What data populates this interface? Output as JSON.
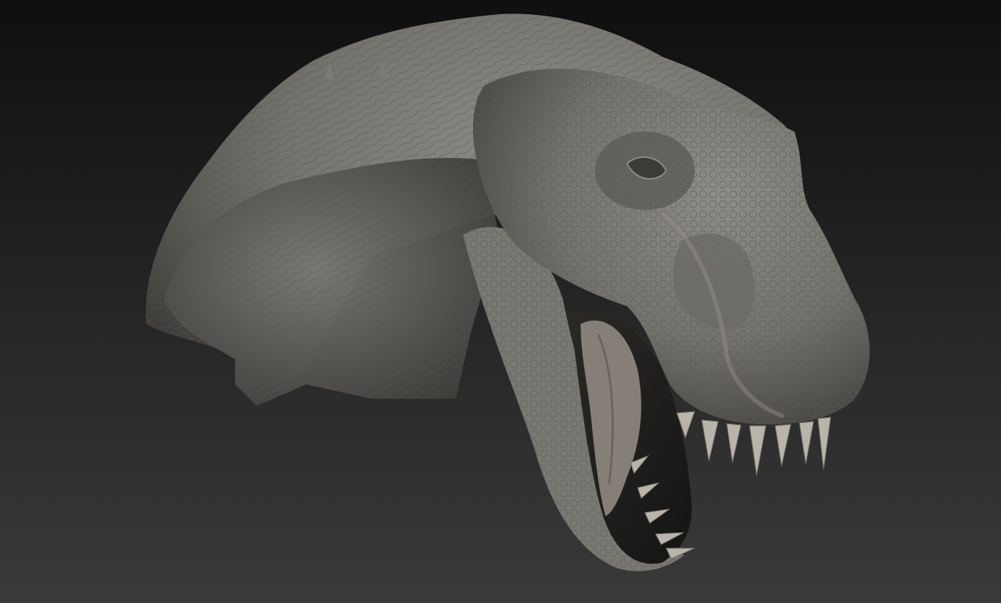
{
  "scene": {
    "subject_icon": "dinosaur-head-icon",
    "background_colors": {
      "top": "#0f0f0f",
      "bottom": "#3a3a3a"
    },
    "material_colors": {
      "skin_light": "#8d8b87",
      "skin_mid": "#6e6c68",
      "skin_dark": "#3a3936",
      "mouth_dark": "#1e1d1b",
      "tooth": "#b9b6ae",
      "tongue": "#7f7b74"
    }
  }
}
